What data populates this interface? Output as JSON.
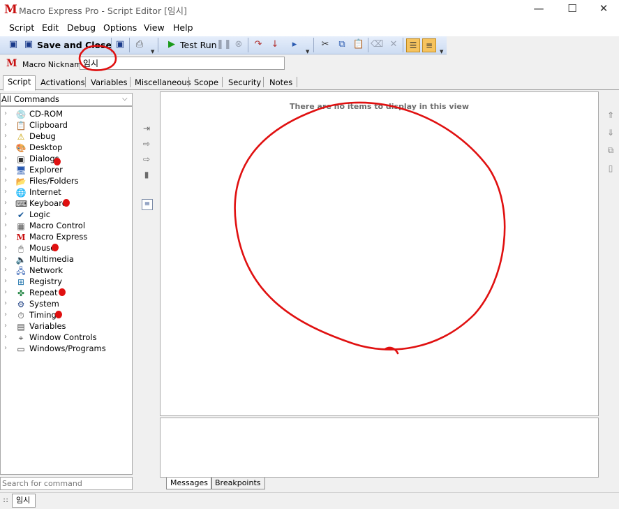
{
  "window": {
    "title": "Macro Express Pro - Script Editor [임시]",
    "app_icon": "M",
    "controls": {
      "minimize": "—",
      "maximize": "☐",
      "close": "✕"
    }
  },
  "menu": [
    "Script",
    "Edit",
    "Debug",
    "Options",
    "View",
    "Help"
  ],
  "toolbar": {
    "save_close_label": "Save and Close",
    "test_run_label": "Test Run",
    "icons": [
      "save-icon",
      "save-icon",
      "save-as-icon",
      "print-icon",
      "play-icon",
      "pause-icon",
      "stop-icon",
      "step-icon",
      "step-into-icon",
      "run-to-icon",
      "cut-icon",
      "copy-icon",
      "paste-icon",
      "eraser-icon",
      "delete-icon",
      "list-view-icon",
      "text-view-icon"
    ]
  },
  "nickname": {
    "label": "Macro Nickname:",
    "value": "임시"
  },
  "tabs": [
    "Script",
    "Activations",
    "Variables",
    "Miscellaneous",
    "Scope",
    "Security",
    "Notes"
  ],
  "active_tab": "Script",
  "commands": {
    "filter": "All Commands",
    "items": [
      {
        "label": "CD-ROM",
        "icon": "cd-icon",
        "glyph": "💿"
      },
      {
        "label": "Clipboard",
        "icon": "clipboard-icon",
        "glyph": "📋"
      },
      {
        "label": "Debug",
        "icon": "warning-icon",
        "glyph": "⚠"
      },
      {
        "label": "Desktop",
        "icon": "desktop-icon",
        "glyph": "🎨"
      },
      {
        "label": "Dialogs",
        "icon": "dialog-icon",
        "glyph": "▣"
      },
      {
        "label": "Explorer",
        "icon": "explorer-icon",
        "glyph": "🖥"
      },
      {
        "label": "Files/Folders",
        "icon": "folder-icon",
        "glyph": "📂"
      },
      {
        "label": "Internet",
        "icon": "internet-icon",
        "glyph": "🌐"
      },
      {
        "label": "Keyboard",
        "icon": "keyboard-icon",
        "glyph": "⌨"
      },
      {
        "label": "Logic",
        "icon": "check-icon",
        "glyph": "✔"
      },
      {
        "label": "Macro Control",
        "icon": "macro-control-icon",
        "glyph": "▦"
      },
      {
        "label": "Macro Express",
        "icon": "macro-express-icon",
        "glyph": "M"
      },
      {
        "label": "Mouse",
        "icon": "mouse-icon",
        "glyph": "🖱"
      },
      {
        "label": "Multimedia",
        "icon": "speaker-icon",
        "glyph": "🔈"
      },
      {
        "label": "Network",
        "icon": "network-icon",
        "glyph": "🖧"
      },
      {
        "label": "Registry",
        "icon": "registry-icon",
        "glyph": "⊞"
      },
      {
        "label": "Repeat",
        "icon": "repeat-icon",
        "glyph": "✤"
      },
      {
        "label": "System",
        "icon": "system-icon",
        "glyph": "⚙"
      },
      {
        "label": "Timing",
        "icon": "timer-icon",
        "glyph": "⏱"
      },
      {
        "label": "Variables",
        "icon": "variables-icon",
        "glyph": "▤"
      },
      {
        "label": "Window Controls",
        "icon": "window-controls-icon",
        "glyph": "⌖"
      },
      {
        "label": "Windows/Programs",
        "icon": "window-icon",
        "glyph": "▭"
      }
    ]
  },
  "search": {
    "placeholder": "Search for command"
  },
  "script_view": {
    "empty_text": "There are no items to display in this view"
  },
  "bottom_tabs": [
    "Messages",
    "Breakpoints"
  ],
  "status": {
    "tab_label": "임시"
  },
  "colors": {
    "annotation": "#e01010",
    "brand": "#c81010",
    "toolbar": "#d6e2f5"
  }
}
